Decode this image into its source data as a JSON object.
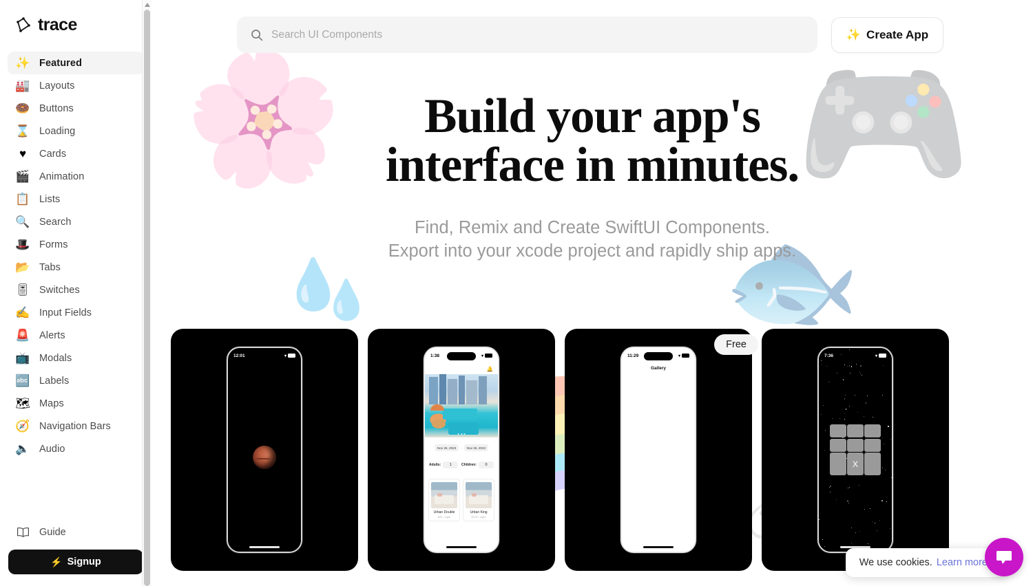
{
  "brand": {
    "name": "trace",
    "logo_icon": "trace-polygon-logo"
  },
  "sidebar": {
    "items": [
      {
        "label": "Featured",
        "icon": "✨",
        "icon_name": "sparkles-icon",
        "active": true
      },
      {
        "label": "Layouts",
        "icon": "🏭",
        "icon_name": "layouts-icon",
        "active": false
      },
      {
        "label": "Buttons",
        "icon": "🍩",
        "icon_name": "donut-icon",
        "active": false
      },
      {
        "label": "Loading",
        "icon": "⌛",
        "icon_name": "hourglass-icon",
        "active": false
      },
      {
        "label": "Cards",
        "icon": "♥",
        "icon_name": "heart-card-icon",
        "active": false
      },
      {
        "label": "Animation",
        "icon": "🎬",
        "icon_name": "clapperboard-icon",
        "active": false
      },
      {
        "label": "Lists",
        "icon": "📋",
        "icon_name": "clipboard-icon",
        "active": false
      },
      {
        "label": "Search",
        "icon": "🔍",
        "icon_name": "magnifier-icon",
        "active": false
      },
      {
        "label": "Forms",
        "icon": "🎩",
        "icon_name": "top-hat-icon",
        "active": false
      },
      {
        "label": "Tabs",
        "icon": "📂",
        "icon_name": "folder-icon",
        "active": false
      },
      {
        "label": "Switches",
        "icon": "🎚",
        "icon_name": "switch-icon",
        "active": false
      },
      {
        "label": "Input Fields",
        "icon": "✍",
        "icon_name": "writing-hand-icon",
        "active": false
      },
      {
        "label": "Alerts",
        "icon": "🚨",
        "icon_name": "siren-icon",
        "active": false
      },
      {
        "label": "Modals",
        "icon": "📺",
        "icon_name": "television-icon",
        "active": false
      },
      {
        "label": "Labels",
        "icon": "🔤",
        "icon_name": "abc-icon",
        "active": false
      },
      {
        "label": "Maps",
        "icon": "🗺",
        "icon_name": "map-icon",
        "active": false
      },
      {
        "label": "Navigation Bars",
        "icon": "🧭",
        "icon_name": "compass-icon",
        "active": false
      },
      {
        "label": "Audio",
        "icon": "🔈",
        "icon_name": "speaker-icon",
        "active": false
      }
    ],
    "guide_label": "Guide",
    "guide_icon_name": "open-book-icon",
    "signup_label": "Signup",
    "signup_icon": "⚡"
  },
  "topbar": {
    "search_placeholder": "Search UI Components",
    "search_value": "",
    "search_icon_name": "search-icon",
    "create_label": "Create App",
    "create_icon": "✨"
  },
  "hero": {
    "title_line1": "Build your app's",
    "title_line2": "interface in minutes.",
    "subtitle_line1": "Find, Remix and Create SwiftUI Components.",
    "subtitle_line2": "Export into your xcode project and rapidly ship apps."
  },
  "decorations": [
    {
      "name": "cherry-blossom-deco",
      "glyph": "🌸"
    },
    {
      "name": "video-game-controller-deco",
      "glyph": "🎮"
    },
    {
      "name": "droplet-deco-1",
      "glyph": "💧"
    },
    {
      "name": "droplet-deco-2",
      "glyph": "💧"
    },
    {
      "name": "tropical-fish-bowl-deco",
      "glyph": "🐟"
    },
    {
      "name": "rainbow-deco",
      "glyph": "🌈"
    },
    {
      "name": "unicorn-deco",
      "glyph": "🦄"
    }
  ],
  "cards": [
    {
      "name": "planet-card",
      "badge": "",
      "time": "12:01",
      "title": ""
    },
    {
      "name": "hotel-booking-card",
      "badge": "",
      "time": "1:38",
      "title": "",
      "checkin": "Nov 26, 2023",
      "checkout": "Nov 26, 2023",
      "date_separator": "-",
      "adults_label": "Adults:",
      "adults_value": "1",
      "children_label": "Children:",
      "children_value": "0",
      "rooms": [
        {
          "name": "Urban Double",
          "price": "$99 / night"
        },
        {
          "name": "Urban King",
          "price": "$129 / night"
        }
      ]
    },
    {
      "name": "gallery-card",
      "badge": "Free",
      "time": "11:29",
      "title": "Gallery"
    },
    {
      "name": "tic-tac-toe-card",
      "badge": "",
      "time": "7:36",
      "title": "",
      "grid": [
        "",
        "",
        "",
        "",
        "",
        "",
        "",
        "X",
        ""
      ]
    }
  ],
  "cookie": {
    "text": "We use cookies.",
    "link": "Learn more"
  },
  "chat": {
    "icon_name": "chat-bubble-icon"
  },
  "colors": {
    "accent_chat": "#c816c8",
    "link": "#6b73d8",
    "card_bg": "#000000",
    "signup_bg": "#111111",
    "search_bg": "#f4f4f4"
  }
}
